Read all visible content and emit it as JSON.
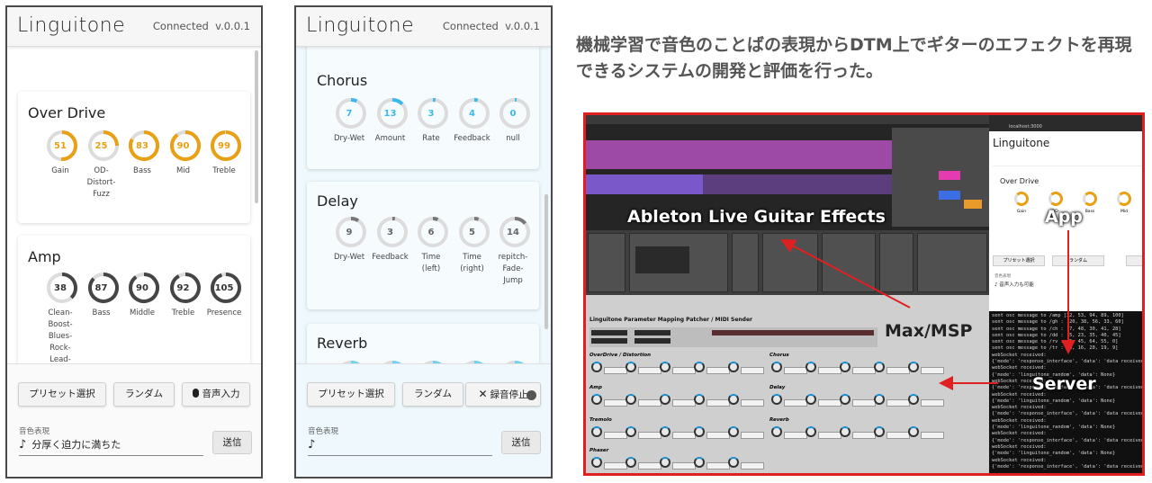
{
  "phone_left": {
    "brand": "Linguitone",
    "status": "Connected",
    "version": "v.0.0.1",
    "cards": [
      {
        "title": "Over Drive",
        "color": "#e8a015",
        "knobs": [
          {
            "value": "51",
            "label": "Gain",
            "level": 0.51
          },
          {
            "value": "25",
            "label": "OD-\nDistort-\nFuzz",
            "level": 0.25
          },
          {
            "value": "83",
            "label": "Bass",
            "level": 0.83
          },
          {
            "value": "90",
            "label": "Mid",
            "level": 0.9
          },
          {
            "value": "99",
            "label": "Treble",
            "level": 0.99
          }
        ]
      },
      {
        "title": "Amp",
        "color": "#454545",
        "knobs": [
          {
            "value": "38",
            "label": "Clean-\nBoost-\nBlues-\nRock-\nLead-",
            "level": 0.38
          },
          {
            "value": "87",
            "label": "Bass",
            "level": 0.87
          },
          {
            "value": "90",
            "label": "Middle",
            "level": 0.9
          },
          {
            "value": "92",
            "label": "Treble",
            "level": 0.92
          },
          {
            "value": "105",
            "label": "Presence",
            "level": 0.95
          }
        ]
      }
    ],
    "buttons": {
      "preset": "プリセット選択",
      "random": "ランダム",
      "voice": "音声入力"
    },
    "field_label": "音色表現",
    "field_value": "分厚く迫力に満ちた",
    "send": "送信"
  },
  "phone_right": {
    "brand": "Linguitone",
    "status": "Connected",
    "version": "v.0.0.1",
    "cards": [
      {
        "title": "Chorus",
        "color": "#3cb9ea",
        "knobs": [
          {
            "value": "7",
            "label": "Dry-Wet",
            "level": 0.07
          },
          {
            "value": "13",
            "label": "Amount",
            "level": 0.13
          },
          {
            "value": "3",
            "label": "Rate",
            "level": 0.03
          },
          {
            "value": "4",
            "label": "Feedback",
            "level": 0.04
          },
          {
            "value": "0",
            "label": "null",
            "level": 0.0
          }
        ]
      },
      {
        "title": "Delay",
        "color": "#777777",
        "knobs": [
          {
            "value": "9",
            "label": "Dry-Wet",
            "level": 0.09
          },
          {
            "value": "3",
            "label": "Feedback",
            "level": 0.03
          },
          {
            "value": "6",
            "label": "Time\n(left)",
            "level": 0.06
          },
          {
            "value": "5",
            "label": "Time\n(right)",
            "level": 0.05
          },
          {
            "value": "14",
            "label": "repitch-\nFade-\nJump",
            "level": 0.14
          }
        ]
      },
      {
        "title": "Reverb",
        "color": "#6fd3ee",
        "knobs": []
      }
    ],
    "buttons": {
      "preset": "プリセット選択",
      "random": "ランダム",
      "stop": "録音停止"
    },
    "field_label": "音色表現",
    "field_value": "",
    "send": "送信"
  },
  "heading": "機械学習で音色のことばの表現からDTM上でギターのエフェクトを再現できるシステムの開発と評価を行った。",
  "composite": {
    "ableton_label": "Ableton Live Guitar Effects",
    "app_label": "App",
    "max_label": "Max/MSP",
    "server_label": "Server",
    "max_title": "Linguitone Parameter Mapping Patcher / MIDI Sender",
    "max_sections_left": [
      "OverDrive / Distortion",
      "Amp",
      "Tremolo",
      "Phaser"
    ],
    "max_sections_right": [
      "Chorus",
      "Delay",
      "Reverb"
    ],
    "browser_url": "localhost:3000",
    "browser_brand": "Linguitone",
    "browser_card_title": "Over Drive",
    "browser_knob_labels": [
      "Gain",
      "OD-",
      "Bass",
      "Mid"
    ],
    "browser_buttons": [
      "プリセット選択",
      "ランダム"
    ],
    "browser_field_label": "音色表現",
    "browser_field_value": "音声入力も可能",
    "terminal_lines": [
      "sent osc message to /amp [32, 53, 94, 89, 100]",
      "sent osc message to /gh : [20, 38, 56, 33, 60]",
      "sent osc message to /ch : [7, 48, 30, 41, 28]",
      "sent osc message to /dd : [5, 23, 35, 40, 45]",
      "sent osc message to /rv : [5, 45, 64, 55, 0]",
      "sent osc message to /tr : [6, 16, 20, 19, 9]",
      "webSocket received:",
      "{'mode': 'response_interface', 'data': 'data received'}",
      "webSocket received:",
      "{'mode': 'linguitone_random', 'data': None}",
      "webSocket received:",
      "{'mode': 'response_interface', 'data': 'data received'}",
      "webSocket received:",
      "{'mode': 'linguitone_random', 'data': None}",
      "webSocket received:",
      "{'mode': 'response_interface', 'data': 'data received'}",
      "webSocket received:",
      "{'mode': 'linguitone_random', 'data': None}",
      "webSocket received:",
      "{'mode': 'response_interface', 'data': 'data received'}",
      "webSocket received:",
      "{'mode': 'linguitone_random', 'data': None}",
      "webSocket received:",
      "{'mode': 'response_interface', 'data': 'data received'}"
    ]
  }
}
